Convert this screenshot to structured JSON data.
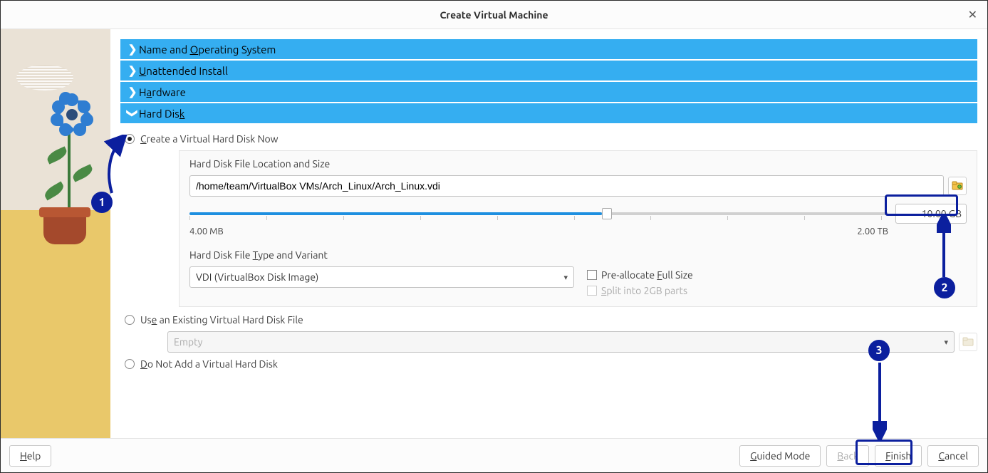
{
  "window": {
    "title": "Create Virtual Machine"
  },
  "accordion": {
    "name": "Name and Operating System",
    "unattended": "Unattended Install",
    "hardware": "Hardware",
    "harddisk": "Hard Disk"
  },
  "radios": {
    "create": "Create a Virtual Hard Disk Now",
    "use_existing": "Use an Existing Virtual Hard Disk File",
    "no_disk": "Do Not Add a Virtual Hard Disk"
  },
  "harddisk": {
    "loc_label": "Hard Disk File Location and Size",
    "path": "/home/team/VirtualBox VMs/Arch_Linux/Arch_Linux.vdi",
    "size_value": "10.00 GB",
    "size_min": "4.00 MB",
    "size_max": "2.00 TB",
    "type_label": "Hard Disk File Type and Variant",
    "type_value": "VDI (VirtualBox Disk Image)",
    "prealloc": "Pre-allocate Full Size",
    "split": "Split into 2GB parts",
    "existing_value": "Empty"
  },
  "footer": {
    "help": "Help",
    "guided": "Guided Mode",
    "back": "Back",
    "finish": "Finish",
    "cancel": "Cancel"
  },
  "annotations": {
    "a1": "1",
    "a2": "2",
    "a3": "3"
  },
  "colors": {
    "accent": "#35aef1",
    "anno": "#0b1f9e"
  }
}
